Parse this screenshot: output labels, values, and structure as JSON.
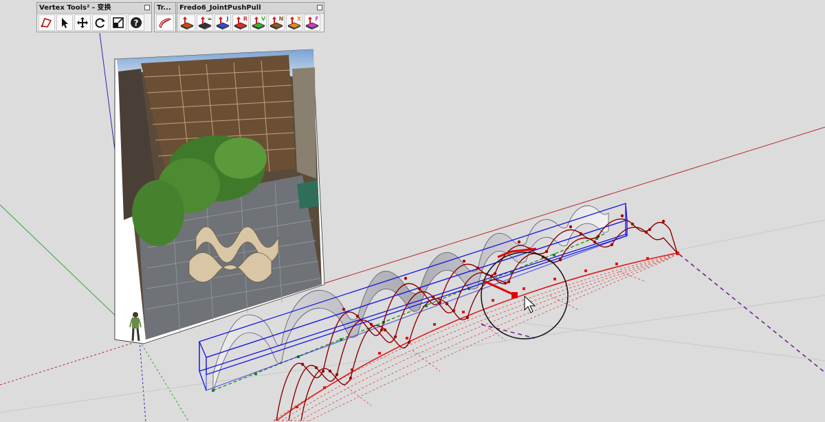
{
  "toolbars": {
    "vertex": {
      "title": "Vertex Tools² - 变换",
      "buttons": [
        "vertex-select-lasso-icon",
        "pointer-icon",
        "move-icon",
        "rotate-icon",
        "scale-icon",
        "help-icon"
      ]
    },
    "tr": {
      "title": "Tr...",
      "buttons": [
        "curviloft-icon"
      ]
    },
    "fredo": {
      "title": "Fredo6_JointPushPull",
      "buttons": [
        {
          "name": "joint-push-pull-icon",
          "letter": "",
          "color": "#c84a14"
        },
        {
          "name": "vector-push-pull-icon",
          "letter": "=",
          "color": "#333333"
        },
        {
          "name": "joint-push-pull-j-icon",
          "letter": "J",
          "color": "#2a4fd6"
        },
        {
          "name": "joint-push-pull-r-icon",
          "letter": "R",
          "color": "#d83030"
        },
        {
          "name": "joint-push-pull-v-icon",
          "letter": "V",
          "color": "#38b030"
        },
        {
          "name": "joint-push-pull-n-icon",
          "letter": "N",
          "color": "#8a5a20"
        },
        {
          "name": "joint-push-pull-x-icon",
          "letter": "X",
          "color": "#e08a20"
        },
        {
          "name": "joint-push-pull-f-icon",
          "letter": "F",
          "color": "#c040c0"
        }
      ]
    }
  },
  "colors": {
    "background": "#dcdcdc",
    "axis_red": "#b42828",
    "axis_green": "#3aa03a",
    "axis_blue": "#2a2aa8",
    "bounding_box": "#1414e6",
    "curve": "#8b0000",
    "handle": "#e00000"
  }
}
